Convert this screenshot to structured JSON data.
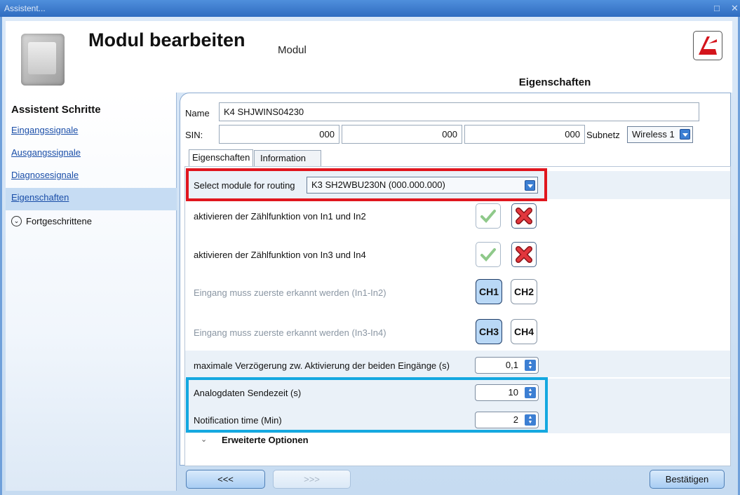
{
  "window": {
    "title": "Assistent...",
    "controls": [
      "□",
      "✕"
    ]
  },
  "header": {
    "title": "Modul bearbeiten",
    "subtitle": "Modul",
    "section_tab": "Eigenschaften"
  },
  "sidebar": {
    "title": "Assistent Schritte",
    "items": [
      {
        "label": "Eingangssignale"
      },
      {
        "label": "Ausgangssignale"
      },
      {
        "label": "Diagnosesignale"
      },
      {
        "label": "Eigenschaften",
        "active": true
      }
    ],
    "advanced": "Fortgeschrittene"
  },
  "form": {
    "name_label": "Name",
    "name_value": "K4 SHJWINS04230",
    "sin_label": "SIN:",
    "sin_values": [
      "000",
      "000",
      "000"
    ],
    "subnet_label": "Subnetz",
    "subnet_value": "Wireless 1"
  },
  "tabs": [
    {
      "label": "Eigenschaften",
      "active": true
    },
    {
      "label": "Information"
    }
  ],
  "properties": {
    "routing_label": "Select module for routing",
    "routing_value": "K3 SH2WBU230N (000.000.000)",
    "count12_label": "aktivieren der Zählfunktion von In1 und In2",
    "count34_label": "aktivieren der Zählfunktion von In3 und In4",
    "first12_label": "Eingang muss zuerste erkannt werden (In1-In2)",
    "first34_label": "Eingang muss zuerste erkannt werden (In3-In4)",
    "ch_buttons": [
      "CH1",
      "CH2",
      "CH3",
      "CH4"
    ],
    "delay_label": "maximale Verzögerung zw. Aktivierung der beiden Eingänge (s)",
    "delay_value": "0,1",
    "analog_label": "Analogdaten Sendezeit (s)",
    "analog_value": "10",
    "notif_label": "Notification time (Min)",
    "notif_value": "2",
    "advanced_options": "Erweiterte Optionen"
  },
  "footer": {
    "back": "<<<",
    "next": ">>>",
    "confirm": "Bestätigen"
  },
  "colors": {
    "highlight_red": "#e0161e",
    "highlight_blue": "#14a8e0"
  }
}
